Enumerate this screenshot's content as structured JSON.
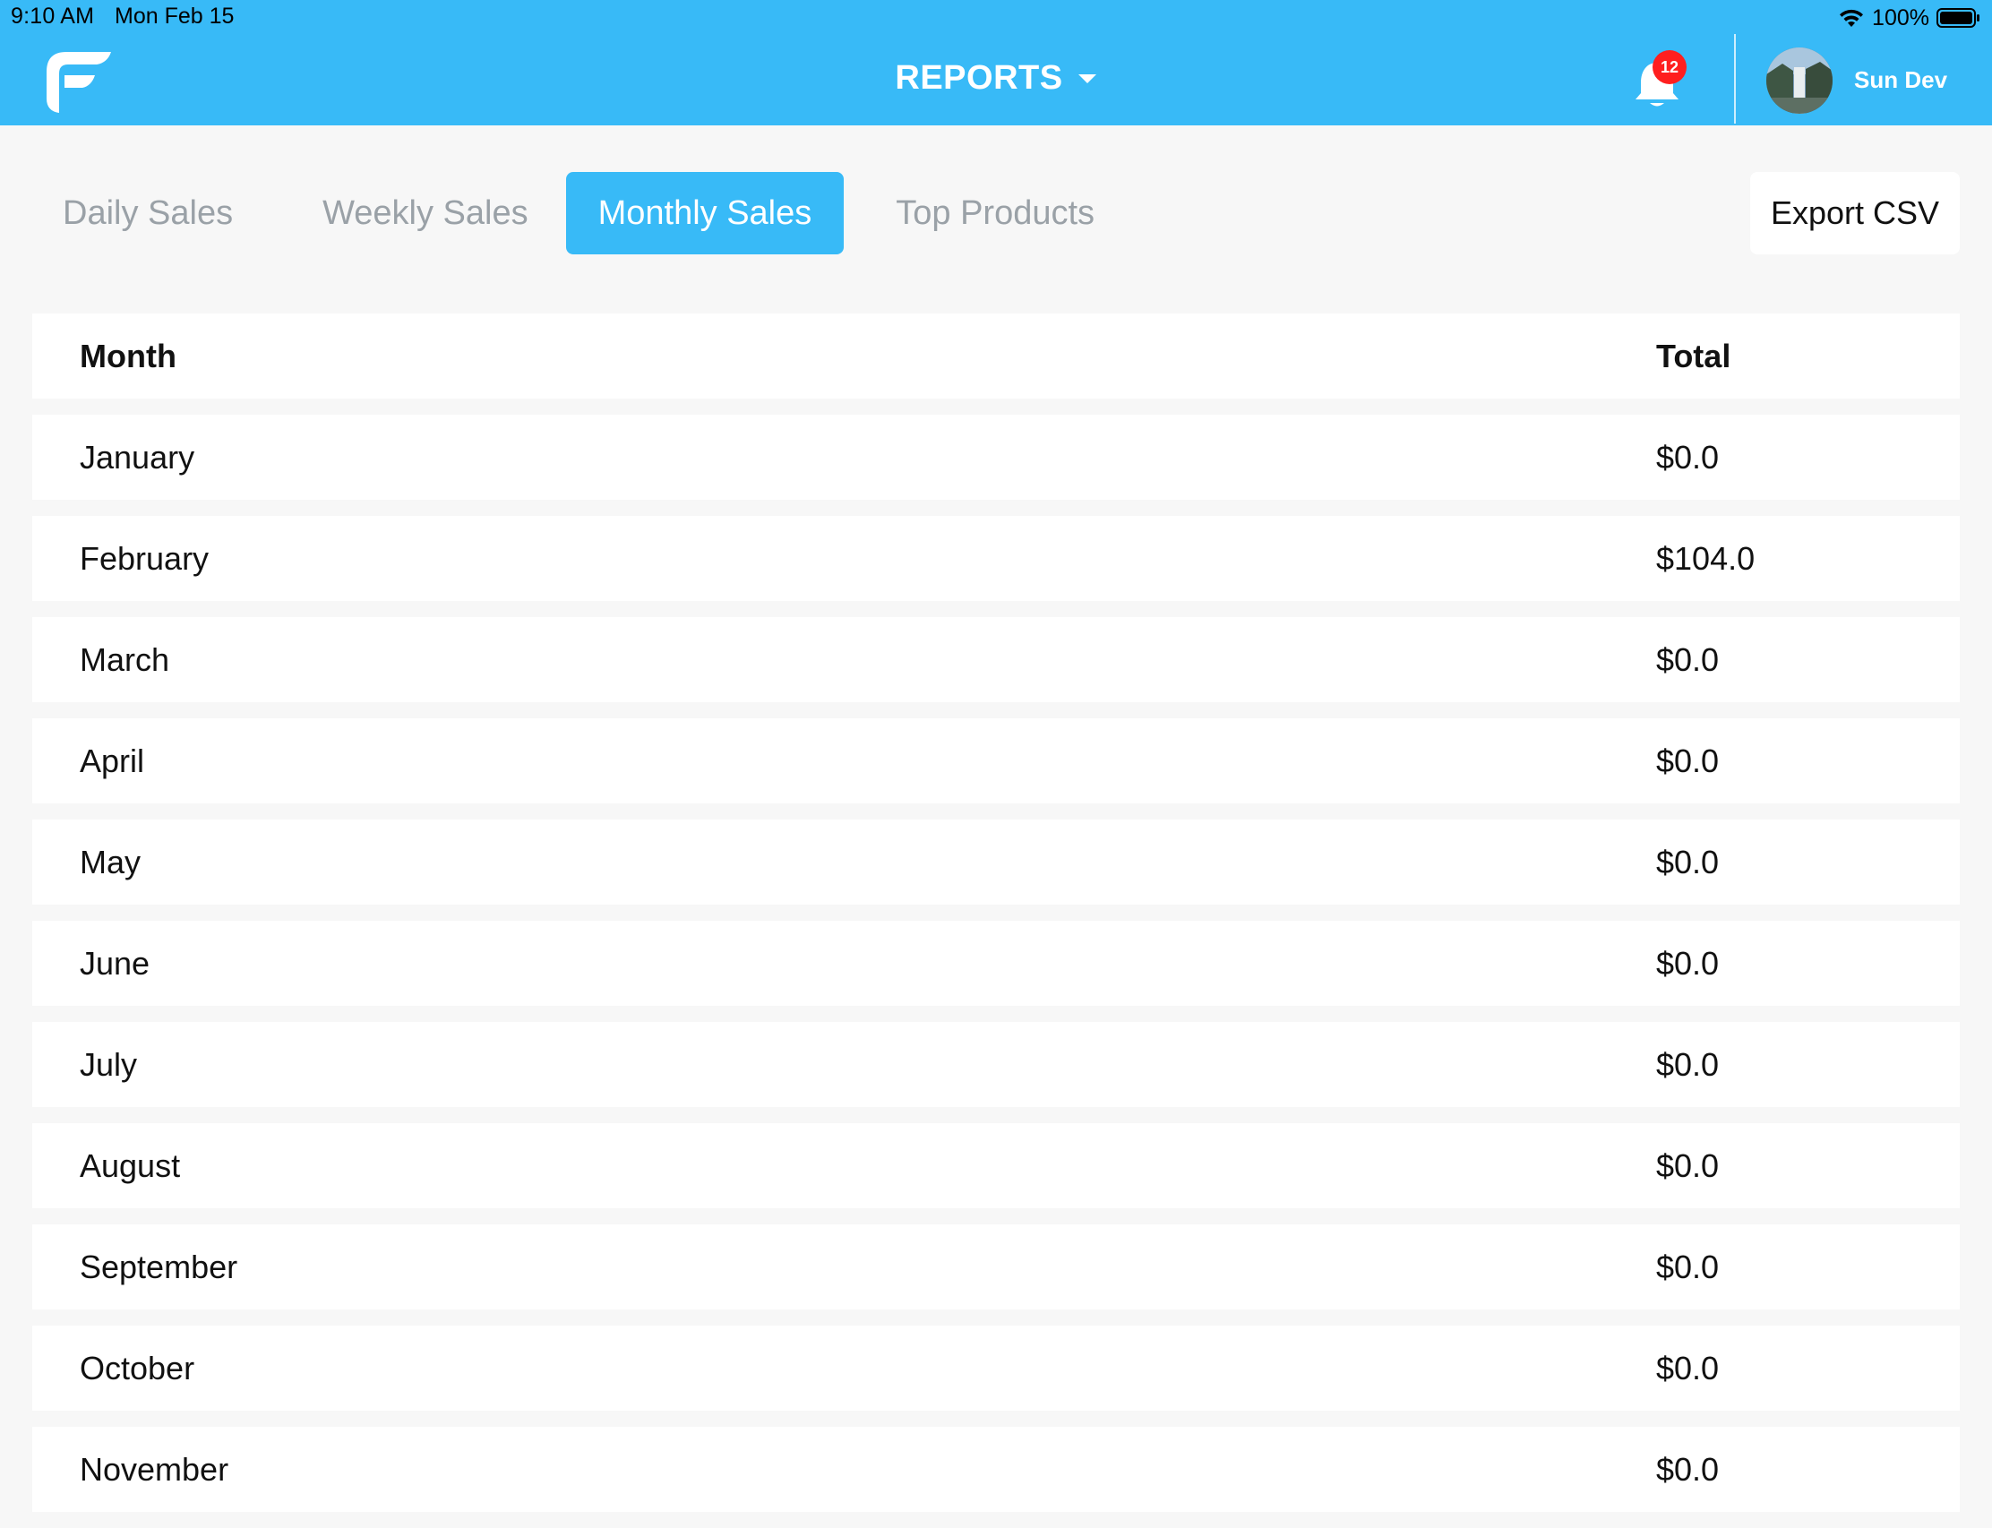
{
  "status_bar": {
    "time": "9:10 AM",
    "date": "Mon Feb 15",
    "battery": "100%"
  },
  "header": {
    "title": "REPORTS",
    "notification_count": "12",
    "user_name": "Sun Dev"
  },
  "tabs": [
    {
      "label": "Daily Sales",
      "active": false
    },
    {
      "label": "Weekly Sales",
      "active": false
    },
    {
      "label": "Monthly Sales",
      "active": true
    },
    {
      "label": "Top Products",
      "active": false
    }
  ],
  "export_label": "Export CSV",
  "table": {
    "columns": [
      "Month",
      "Total"
    ],
    "rows": [
      {
        "month": "January",
        "total": "$0.0"
      },
      {
        "month": "February",
        "total": "$104.0"
      },
      {
        "month": "March",
        "total": "$0.0"
      },
      {
        "month": "April",
        "total": "$0.0"
      },
      {
        "month": "May",
        "total": "$0.0"
      },
      {
        "month": "June",
        "total": "$0.0"
      },
      {
        "month": "July",
        "total": "$0.0"
      },
      {
        "month": "August",
        "total": "$0.0"
      },
      {
        "month": "September",
        "total": "$0.0"
      },
      {
        "month": "October",
        "total": "$0.0"
      },
      {
        "month": "November",
        "total": "$0.0"
      }
    ]
  },
  "colors": {
    "brand": "#38baf7",
    "badge": "#ff1f1f",
    "background": "#f7f7f7"
  }
}
